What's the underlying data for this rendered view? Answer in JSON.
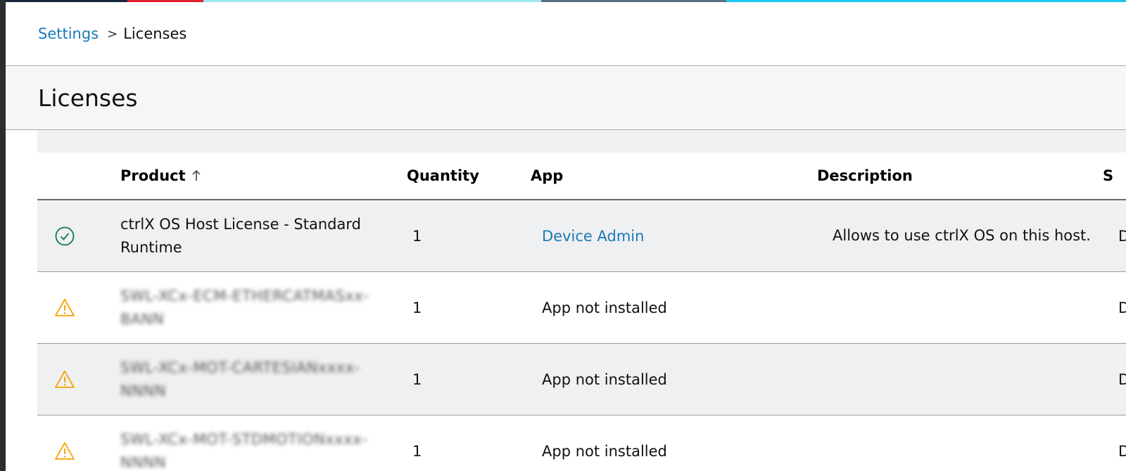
{
  "breadcrumb": {
    "parent": "Settings",
    "separator": ">",
    "current": "Licenses"
  },
  "page": {
    "title": "Licenses"
  },
  "table": {
    "columns": {
      "product": "Product",
      "quantity": "Quantity",
      "app": "App",
      "description": "Description",
      "partial": "S"
    },
    "rows": [
      {
        "status": "check-circle-icon",
        "product": "ctrlX OS Host License - Standard Runtime",
        "quantity": "1",
        "app": "Device Admin",
        "description": "Allows to use ctrlX OS on this host.",
        "partial": "D"
      },
      {
        "status": "warning-icon",
        "product": "SWL-XCx-ECM-ETHERCATMASxx-BANN",
        "quantity": "1",
        "app": "App not installed",
        "description": "",
        "partial": "D"
      },
      {
        "status": "warning-icon",
        "product": "SWL-XCx-MOT-CARTESIANxxxx-NNNN",
        "quantity": "1",
        "app": "App not installed",
        "description": "",
        "partial": "D"
      },
      {
        "status": "warning-icon",
        "product": "SWL-XCx-MOT-STDMOTIONxxxx-NNNN",
        "quantity": "1",
        "app": "App not installed",
        "description": "",
        "partial": "D"
      }
    ]
  },
  "colors": {
    "accent_bar": [
      "#17263a",
      "#e0202e",
      "#9ee8f2",
      "#5a6f80",
      "#1ec7ef"
    ],
    "link": "#1a7ab8",
    "success": "#0f7a4a",
    "warning": "#f5a500"
  }
}
